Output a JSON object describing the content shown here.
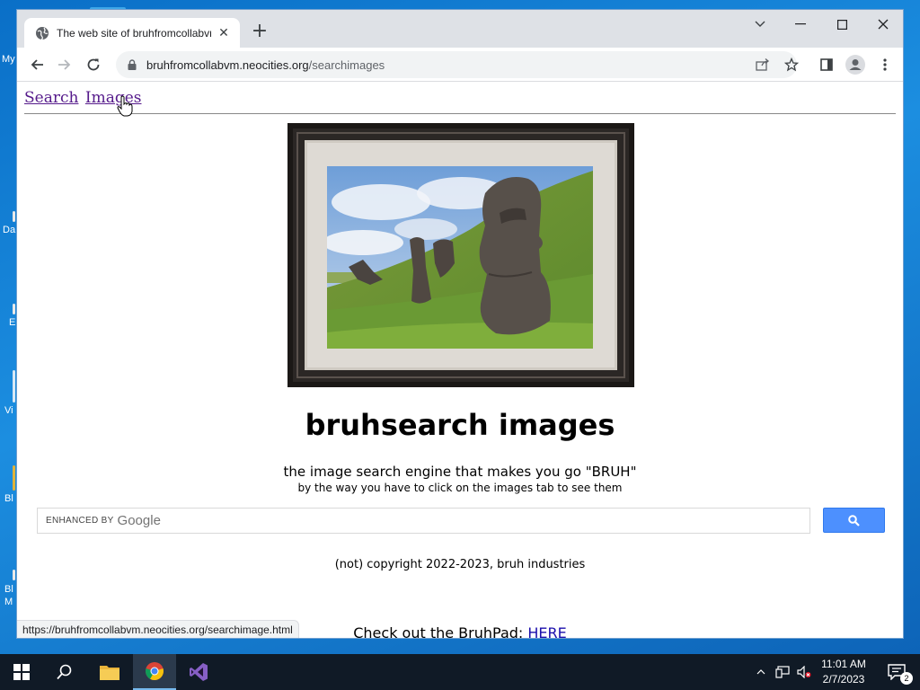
{
  "desktop": {
    "icons": [
      {
        "label": "My",
        "name": "desktop-icon-my"
      },
      {
        "label": "Da",
        "name": "desktop-icon-da"
      },
      {
        "label": "E",
        "name": "desktop-icon-e"
      },
      {
        "label": "Vi",
        "name": "desktop-icon-vi"
      },
      {
        "label": "Bl",
        "name": "desktop-icon-bl"
      },
      {
        "label": "Bl M",
        "name": "desktop-icon-blm"
      }
    ]
  },
  "browser": {
    "tab_title": "The web site of bruhfromcollabvm",
    "new_tab": "+",
    "url_host": "bruhfromcollabvm.neocities.org",
    "url_path": "/searchimages",
    "status_link": "https://bruhfromcollabvm.neocities.org/searchimage.html"
  },
  "page": {
    "nav": {
      "search": "Search",
      "images": "Images"
    },
    "title": "bruhsearch images",
    "tagline": "the image search engine that makes you go \"BRUH\"",
    "subtagline": "by the way you have to click on the images tab to see them",
    "search": {
      "enhanced_by": "ENHANCED BY",
      "google": "Google"
    },
    "copyright": "(not) copyright 2022-2023, bruh industries",
    "bruhpad_text": "Check out the BruhPad: ",
    "bruhpad_link": "HERE"
  },
  "taskbar": {
    "time": "11:01 AM",
    "date": "2/7/2023",
    "notification_count": "2"
  },
  "colors": {
    "link_visited": "#551a8b",
    "link": "#1a0dab",
    "search_button": "#4d90fe",
    "taskbar": "#101a26"
  }
}
